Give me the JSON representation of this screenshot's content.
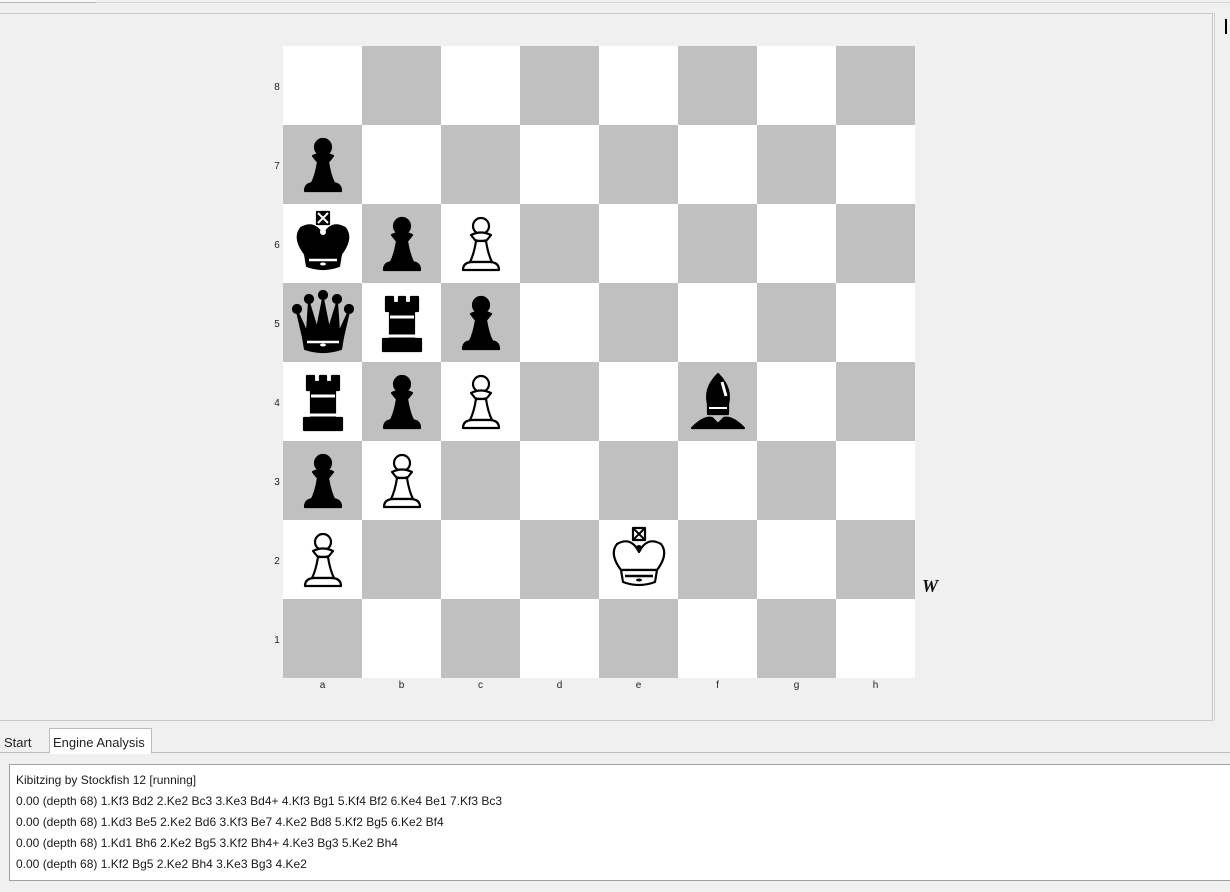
{
  "board": {
    "files": [
      "a",
      "b",
      "c",
      "d",
      "e",
      "f",
      "g",
      "h"
    ],
    "ranks": [
      "8",
      "7",
      "6",
      "5",
      "4",
      "3",
      "2",
      "1"
    ],
    "side_to_move": "W",
    "pieces": [
      {
        "square": "a7",
        "color": "black",
        "type": "pawn"
      },
      {
        "square": "a6",
        "color": "black",
        "type": "king"
      },
      {
        "square": "b6",
        "color": "black",
        "type": "pawn"
      },
      {
        "square": "c6",
        "color": "white",
        "type": "pawn"
      },
      {
        "square": "a5",
        "color": "black",
        "type": "queen"
      },
      {
        "square": "b5",
        "color": "black",
        "type": "rook"
      },
      {
        "square": "c5",
        "color": "black",
        "type": "pawn"
      },
      {
        "square": "a4",
        "color": "black",
        "type": "rook"
      },
      {
        "square": "b4",
        "color": "black",
        "type": "pawn"
      },
      {
        "square": "c4",
        "color": "white",
        "type": "pawn"
      },
      {
        "square": "f4",
        "color": "black",
        "type": "bishop"
      },
      {
        "square": "a3",
        "color": "black",
        "type": "pawn"
      },
      {
        "square": "b3",
        "color": "white",
        "type": "pawn"
      },
      {
        "square": "a2",
        "color": "white",
        "type": "pawn"
      },
      {
        "square": "e2",
        "color": "white",
        "type": "king"
      }
    ]
  },
  "tabs": [
    {
      "label": "Start",
      "active": false
    },
    {
      "label": "Engine Analysis",
      "active": true
    }
  ],
  "analysis": {
    "lines": [
      "Kibitzing by Stockfish 12 [running]",
      "0.00 (depth 68) 1.Kf3 Bd2 2.Ke2 Bc3 3.Ke3 Bd4+ 4.Kf3 Bg1 5.Kf4 Bf2 6.Ke4 Be1 7.Kf3 Bc3",
      "0.00 (depth 68) 1.Kd3 Be5 2.Ke2 Bd6 3.Kf3 Be7 4.Ke2 Bd8 5.Kf2 Bg5 6.Ke2 Bf4",
      "0.00 (depth 68) 1.Kd1 Bh6 2.Ke2 Bg5 3.Kf2 Bh4+ 4.Ke3 Bg3 5.Ke2 Bh4",
      "0.00 (depth 68) 1.Kf2 Bg5 2.Ke2 Bh4 3.Ke3 Bg3 4.Ke2"
    ]
  },
  "colors": {
    "light_square": "#ffffff",
    "dark_square": "#c0c0c0",
    "panel_bg": "#f0f0f0"
  }
}
